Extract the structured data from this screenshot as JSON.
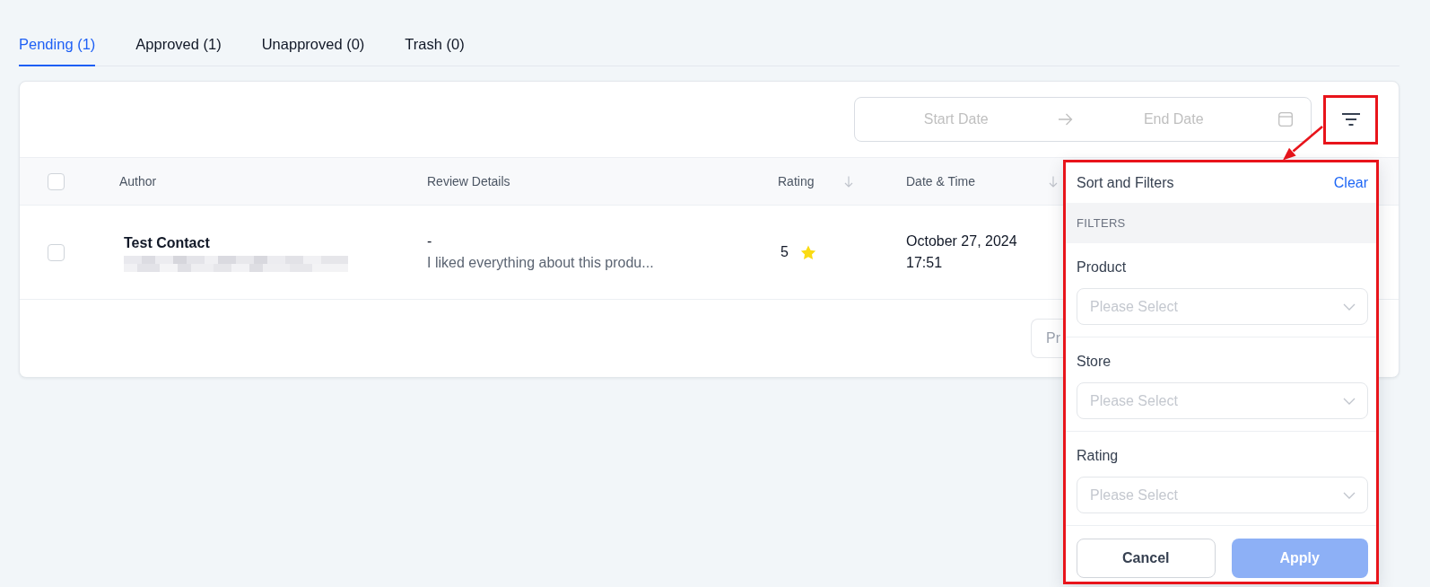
{
  "tabs": [
    {
      "label": "Pending (1)",
      "selected": true
    },
    {
      "label": "Approved (1)",
      "selected": false
    },
    {
      "label": "Unapproved (0)",
      "selected": false
    },
    {
      "label": "Trash (0)",
      "selected": false
    }
  ],
  "toolbar": {
    "date_range": {
      "start": {
        "placeholder": "Start Date"
      },
      "end": {
        "placeholder": "End Date"
      }
    },
    "filter_button": {
      "highlighted": true
    }
  },
  "table": {
    "select_all": {
      "checked": false
    },
    "columns": [
      {
        "label": "Author",
        "sortable": false
      },
      {
        "label": "Review Details",
        "sortable": false
      },
      {
        "label": "Rating",
        "sortable": true
      },
      {
        "label": "Date & Time",
        "sortable": true
      }
    ],
    "rows": [
      {
        "checked": false,
        "author_name": "Test Contact",
        "email_redacted": true,
        "review_title": "-",
        "review_text": "I liked everything about this produ...",
        "rating": "5",
        "date": "October 27, 2024",
        "time": "17:51"
      }
    ]
  },
  "pagination": {
    "button_label": "Pr"
  },
  "filter_panel": {
    "highlighted": true,
    "callout_arrow": true,
    "title": "Sort and Filters",
    "clear_label": "Clear",
    "section_label": "FILTERS",
    "filters": [
      {
        "label": "Product",
        "placeholder": "Please Select"
      },
      {
        "label": "Store",
        "placeholder": "Please Select"
      },
      {
        "label": "Rating",
        "placeholder": "Please Select"
      }
    ],
    "cancel_label": "Cancel",
    "apply": {
      "label": "Apply",
      "disabled": true
    }
  }
}
